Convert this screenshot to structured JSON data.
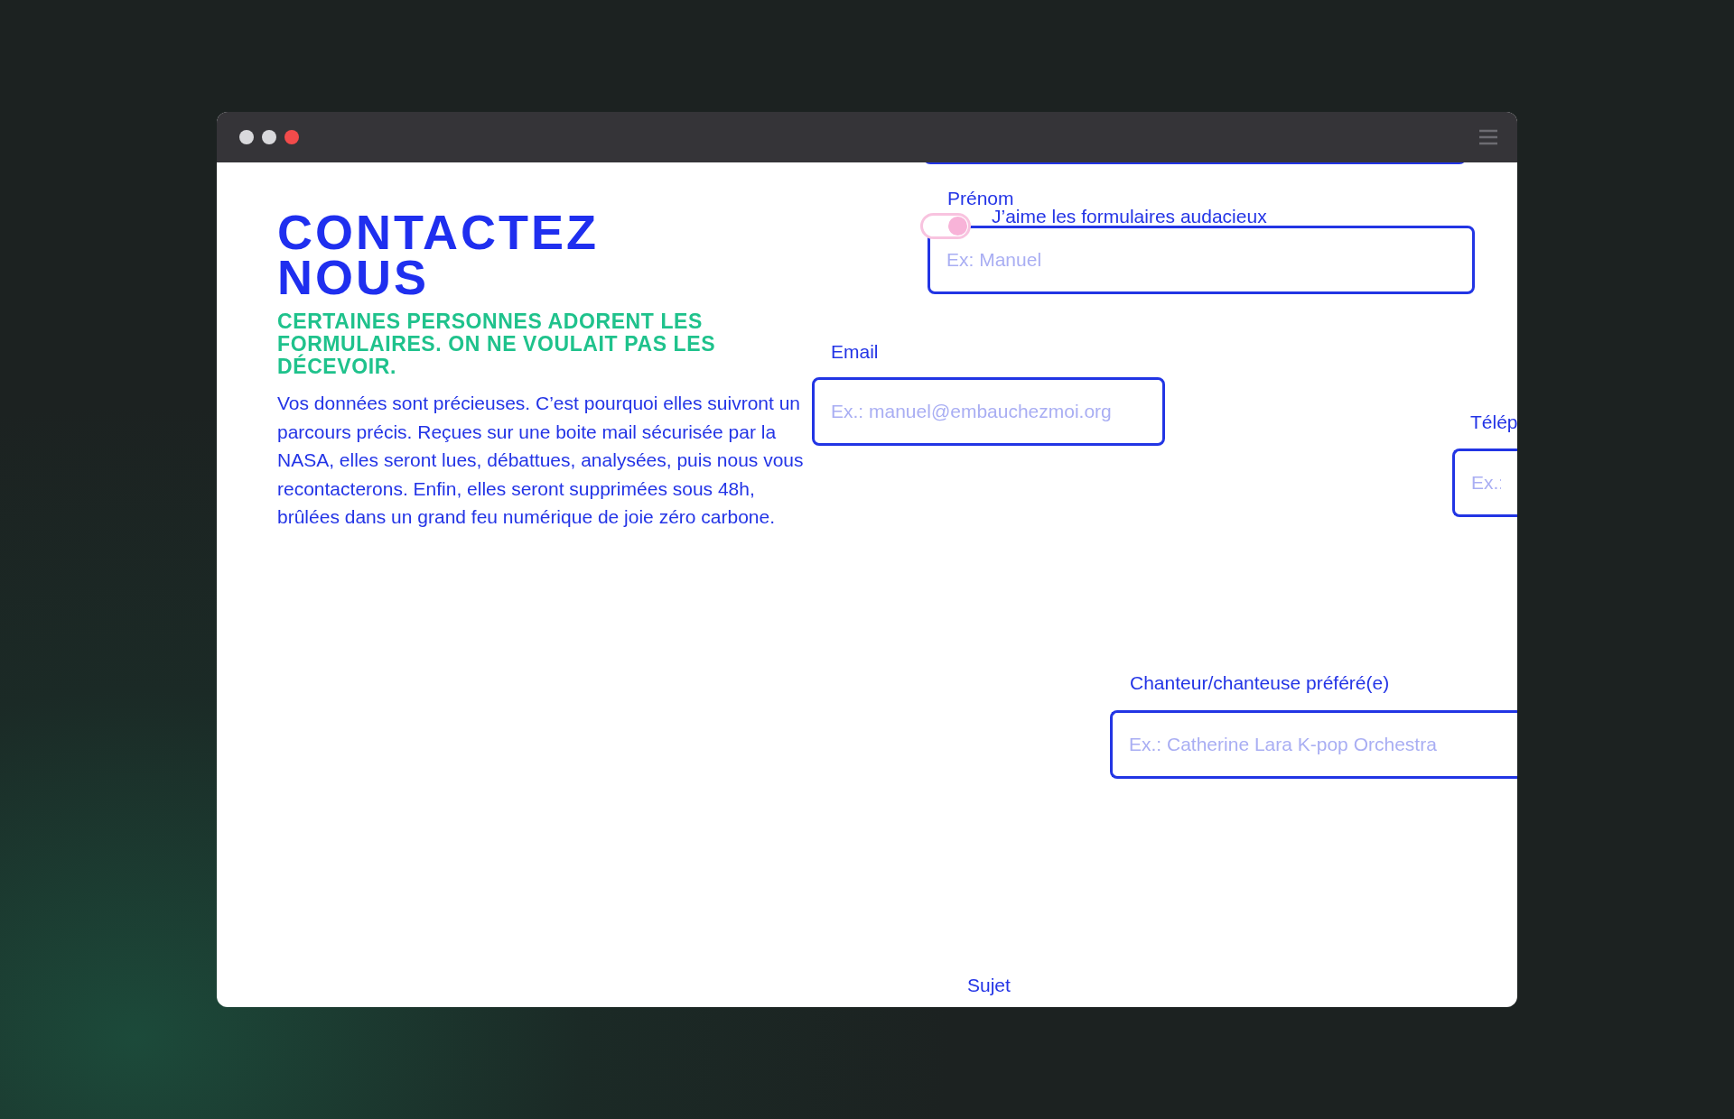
{
  "window": {
    "controls": [
      {
        "color": "#d9d9dc"
      },
      {
        "color": "#d9d9dc"
      },
      {
        "color": "#f24b4b"
      }
    ]
  },
  "heading": "CONTACTEZ NOUS",
  "subtitle": "CERTAINES PERSONNES ADORENT LES FORMULAIRES. ON NE VOULAIT PAS LES DÉCEVOIR.",
  "intro": "Vos données sont précieuses. C’est pourquoi elles suivront un parcours précis. Reçues sur une boite mail sécurisée par la NASA, elles seront lues, débattues, analysées, puis nous vous recontacterons. Enfin, elles seront supprimées sous 48h, brûlées dans un grand feu numérique de joie zéro carbone.",
  "toggle": {
    "label": "J’aime les formulaires audacieux",
    "on": true
  },
  "fields": [
    {
      "kind": "edge"
    },
    {
      "kind": "field",
      "label": "Prénom",
      "placeholder": "Ex: Manuel"
    },
    {
      "kind": "field",
      "label": "Email",
      "placeholder": "Ex.: manuel@embauchezmoi.org"
    },
    {
      "kind": "field",
      "label": "Télép",
      "placeholder": "Ex.:"
    },
    {
      "kind": "field",
      "label": "Chanteur/chanteuse préféré(e)",
      "placeholder": "Ex.: Catherine Lara K-pop Orchestra"
    },
    {
      "kind": "label",
      "label": "Sujet"
    }
  ]
}
